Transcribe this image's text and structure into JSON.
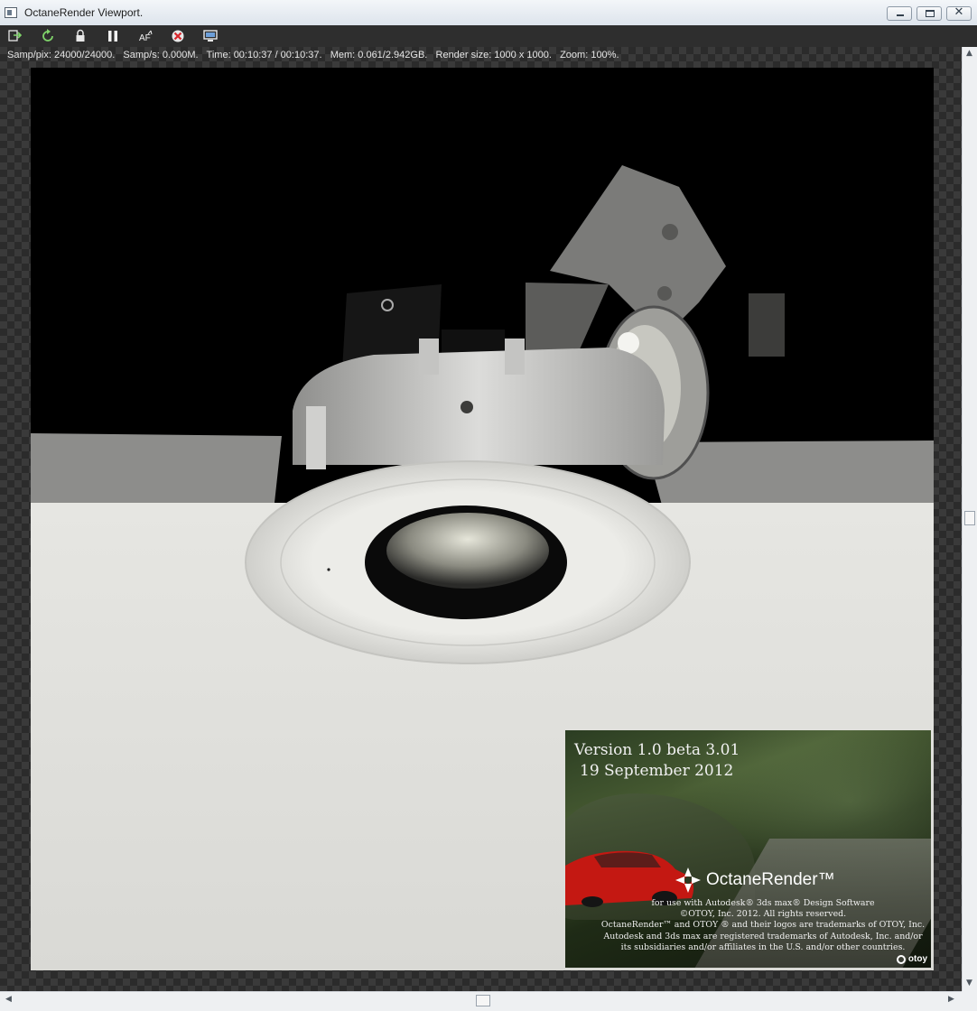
{
  "window": {
    "title": "OctaneRender Viewport."
  },
  "toolbar": {
    "buttons": [
      {
        "icon": "send-scene-icon",
        "tooltip": ""
      },
      {
        "icon": "restart-render-icon"
      },
      {
        "icon": "lock-icon"
      },
      {
        "icon": "pause-icon"
      },
      {
        "icon": "autofocus-icon",
        "text": "AF"
      },
      {
        "icon": "stop-render-icon"
      },
      {
        "icon": "display-settings-icon"
      }
    ]
  },
  "status": {
    "text": "Samp/pix: 24000/24000.   Samp/s: 0.000M.   Time: 00:10:37 / 00:10:37.   Mem: 0.061/2.942GB.   Render size: 1000 x 1000.   Zoom: 100%."
  },
  "splash": {
    "version": "Version 1.0 beta 3.01",
    "date": "19 September 2012",
    "brand": "OctaneRender™",
    "legal": [
      "for use with Autodesk® 3ds max® Design Software",
      "©OTOY, Inc. 2012. All rights reserved.",
      "OctaneRender™ and OTOY ® and their logos are trademarks of OTOY, Inc.",
      "Autodesk and 3ds max are registered trademarks of Autodesk, Inc. and/or",
      "its subsidiaries and/or affiliates in the U.S. and/or other countries."
    ],
    "otoy_logo": "otoy"
  },
  "colors": {
    "toolbar_bg": "#2e2e2e",
    "status_text": "#e6e6e6"
  }
}
